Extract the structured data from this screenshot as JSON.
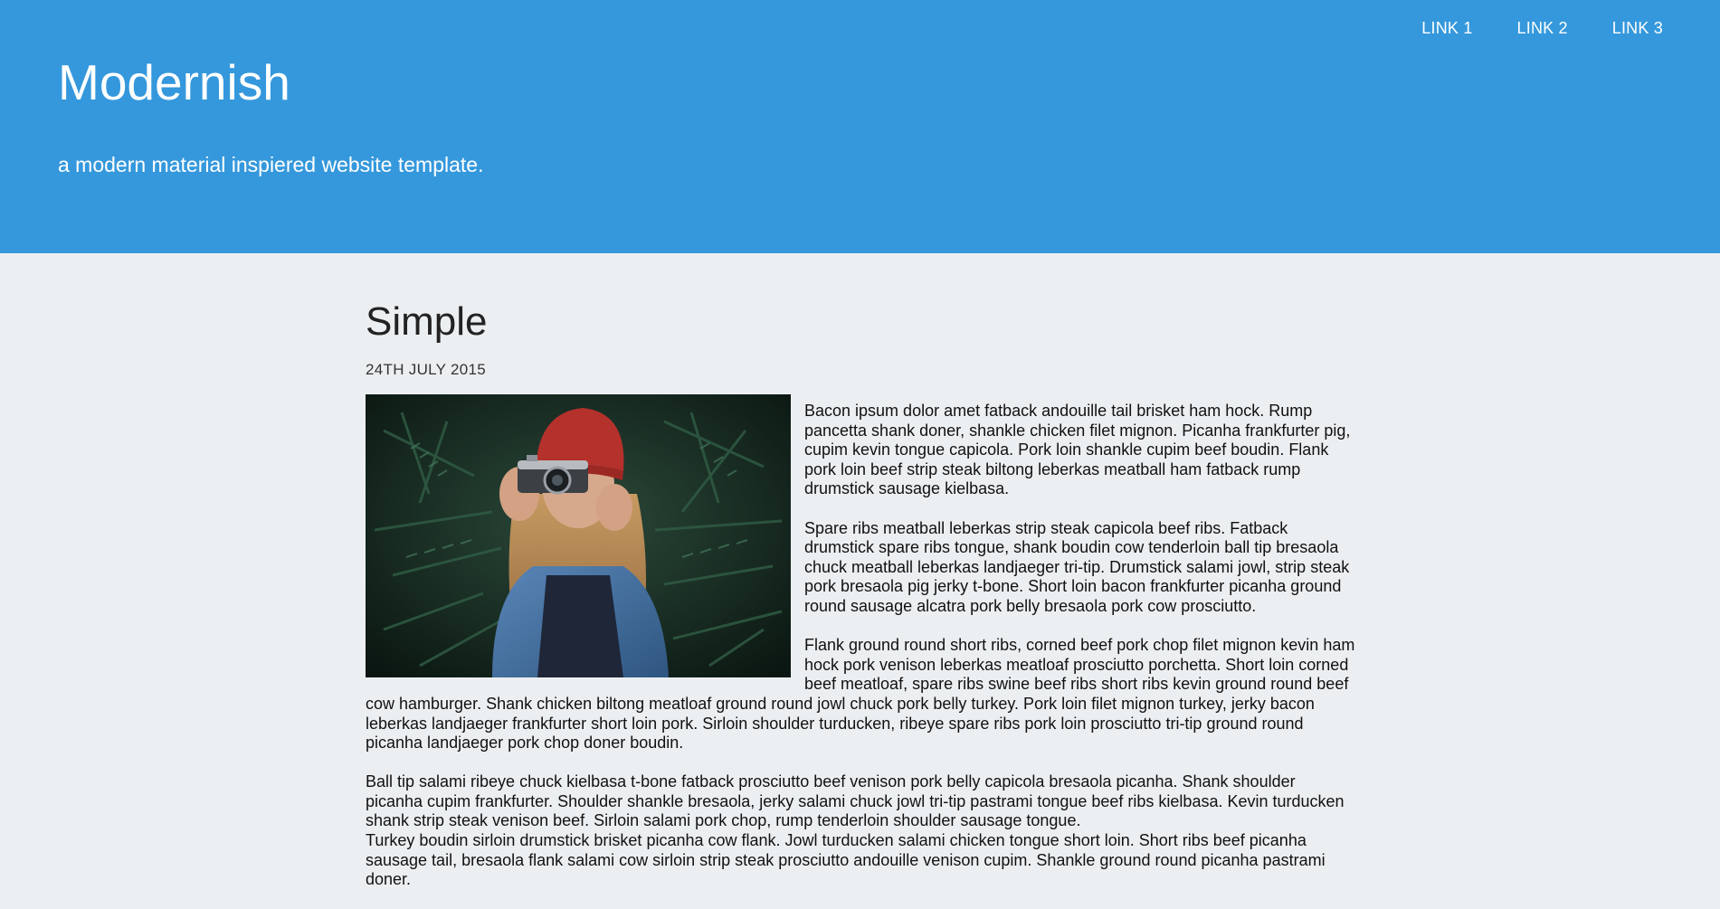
{
  "nav": {
    "links": [
      {
        "label": "LINK 1"
      },
      {
        "label": "LINK 2"
      },
      {
        "label": "LINK 3"
      }
    ]
  },
  "site": {
    "title": "Modernish",
    "tagline": "a modern material inspiered website template."
  },
  "post": {
    "title": "Simple",
    "date": "24TH JULY 2015",
    "paragraphs": [
      "Bacon ipsum dolor amet fatback andouille tail brisket ham hock. Rump pancetta shank doner, shankle chicken filet mignon. Picanha frankfurter pig, cupim kevin tongue capicola. Pork loin shankle cupim beef boudin. Flank pork loin beef strip steak biltong leberkas meatball ham fatback rump drumstick sausage kielbasa.",
      "Spare ribs meatball leberkas strip steak capicola beef ribs. Fatback drumstick spare ribs tongue, shank boudin cow tenderloin ball tip bresaola chuck meatball leberkas landjaeger tri-tip. Drumstick salami jowl, strip steak pork bresaola pig jerky t-bone. Short loin bacon frankfurter picanha ground round sausage alcatra pork belly bresaola pork cow prosciutto.",
      "Flank ground round short ribs, corned beef pork chop filet mignon kevin ham hock pork venison leberkas meatloaf prosciutto porchetta. Short loin corned beef meatloaf, spare ribs swine beef ribs short ribs kevin ground round beef cow hamburger. Shank chicken biltong meatloaf ground round jowl chuck pork belly turkey. Pork loin filet mignon turkey, jerky bacon leberkas landjaeger frankfurter short loin pork. Sirloin shoulder turducken, ribeye spare ribs pork loin prosciutto tri-tip ground round picanha landjaeger pork chop doner boudin.",
      "Ball tip salami ribeye chuck kielbasa t-bone fatback prosciutto beef venison pork belly capicola bresaola picanha. Shank shoulder picanha cupim frankfurter. Shoulder shankle bresaola, jerky salami chuck jowl tri-tip pastrami tongue beef ribs kielbasa. Kevin turducken shank strip steak venison beef. Sirloin salami pork chop, rump tenderloin shoulder sausage tongue.",
      "Turkey boudin sirloin drumstick brisket picanha cow flank. Jowl turducken salami chicken tongue short loin. Short ribs beef picanha sausage tail, bresaola flank salami cow sirloin strip steak prosciutto andouille venison cupim. Shankle ground round picanha pastrami doner."
    ]
  },
  "colors": {
    "header_bg": "#3598dc",
    "page_bg": "#eceff1"
  }
}
